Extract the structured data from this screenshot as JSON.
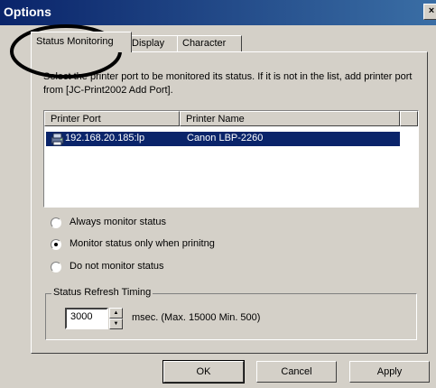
{
  "window": {
    "title": "Options",
    "close_glyph": "×"
  },
  "tabs": [
    {
      "label": "Status Monitoring",
      "active": true
    },
    {
      "label": "Display",
      "active": false
    },
    {
      "label": "Character",
      "active": false
    }
  ],
  "description": "Select the printer port to be monitored its status. If it is not in the list, add printer port from [JC-Print2002 Add Port].",
  "list": {
    "columns": [
      "Printer Port",
      "Printer Name"
    ],
    "rows": [
      {
        "port": "192.168.20.185:lp",
        "name": "Canon LBP-2260",
        "icon": "printer-icon",
        "selected": true
      }
    ]
  },
  "monitor_options": [
    {
      "label": "Always monitor status",
      "checked": false
    },
    {
      "label": "Monitor status only when prinitng",
      "checked": true
    },
    {
      "label": "Do not monitor status",
      "checked": false
    }
  ],
  "refresh": {
    "group_label": "Status Refresh Timing",
    "value": "3000",
    "note": "msec. (Max. 15000  Min. 500)"
  },
  "buttons": {
    "ok": "OK",
    "cancel": "Cancel",
    "apply": "Apply"
  },
  "colors": {
    "title_bar": "#0a246a",
    "selection": "#0a246a",
    "face": "#d4d0c8",
    "annotation": "#000000"
  }
}
